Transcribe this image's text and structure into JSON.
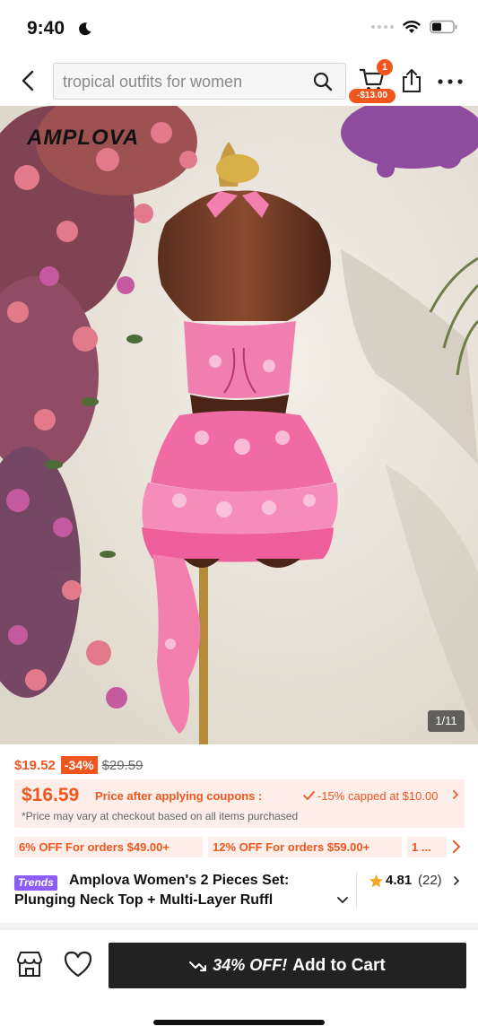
{
  "status_bar": {
    "time": "9:40"
  },
  "search": {
    "query": "tropical outfits for women"
  },
  "header": {
    "cart_badge": "1",
    "cart_discount": "-$13.00"
  },
  "image": {
    "watermark": "AMPLOVA",
    "counter": "1/11"
  },
  "price": {
    "original": "$19.52",
    "discount": "-34%",
    "strikethrough": "$29.59"
  },
  "coupon": {
    "price": "$16.59",
    "label": "Price after applying coupons :",
    "cap": "-15% capped at $10.00",
    "note": "*Price may vary at checkout based on all items purchased"
  },
  "promos": [
    "6% OFF For orders $49.00+",
    "12% OFF For orders $59.00+",
    "1 ..."
  ],
  "product": {
    "badge": "Trends",
    "title_line1": "Amplova Women's 2 Pieces Set:",
    "title_line2": "Plunging Neck Top + Multi-Layer Ruffl",
    "rating": "4.81",
    "reviews": "(22)"
  },
  "cta": {
    "off": "34% OFF!",
    "label": "Add to Cart"
  },
  "colors": {
    "accent": "#f0561e",
    "coupon_bg": "#fdeee9",
    "trends": "#8b5cf6",
    "cta_bg": "#222222",
    "star": "#f5a623"
  }
}
